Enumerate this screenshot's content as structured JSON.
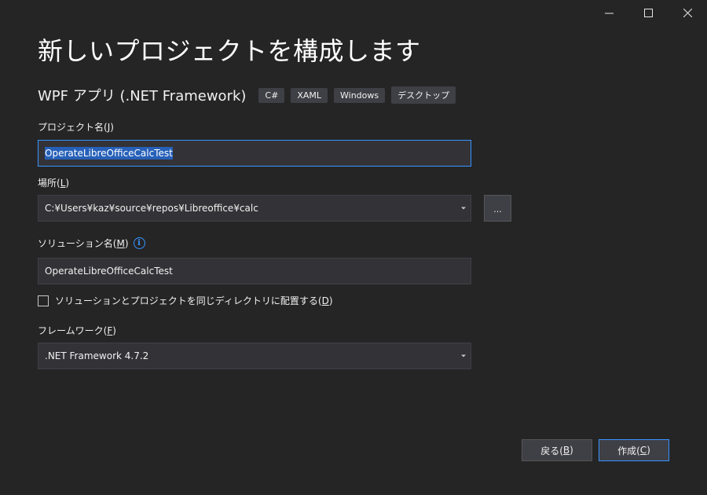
{
  "window": {
    "controls": [
      "minimize-icon",
      "maximize-icon",
      "close-icon"
    ]
  },
  "header": {
    "title": "新しいプロジェクトを構成します",
    "template_name": "WPF アプリ (.NET Framework)",
    "tags": [
      "C#",
      "XAML",
      "Windows",
      "デスクトップ"
    ]
  },
  "project_name": {
    "label": "プロジェクト名(",
    "accel": "J",
    "label_end": ")",
    "value": "OperateLibreOfficeCalcTest"
  },
  "location": {
    "label": "場所(",
    "accel": "L",
    "label_end": ")",
    "value": "C:¥Users¥kaz¥source¥repos¥Libreoffice¥calc",
    "browse_label": "..."
  },
  "solution_name": {
    "label": "ソリューション名(",
    "accel": "M",
    "label_end": ")",
    "info_icon": "info-icon",
    "value": "OperateLibreOfficeCalcTest"
  },
  "same_dir": {
    "label": "ソリューションとプロジェクトを同じディレクトリに配置する(",
    "accel": "D",
    "label_end": ")",
    "checked": false
  },
  "framework": {
    "label": "フレームワーク(",
    "accel": "F",
    "label_end": ")",
    "value": ".NET Framework 4.7.2"
  },
  "buttons": {
    "back_label": "戻る(",
    "back_accel": "B",
    "back_end": ")",
    "create_label": "作成(",
    "create_accel": "C",
    "create_end": ")"
  },
  "colors": {
    "background": "#252526",
    "input": "#333337",
    "accent": "#3794ff",
    "selection": "#2660b8"
  }
}
